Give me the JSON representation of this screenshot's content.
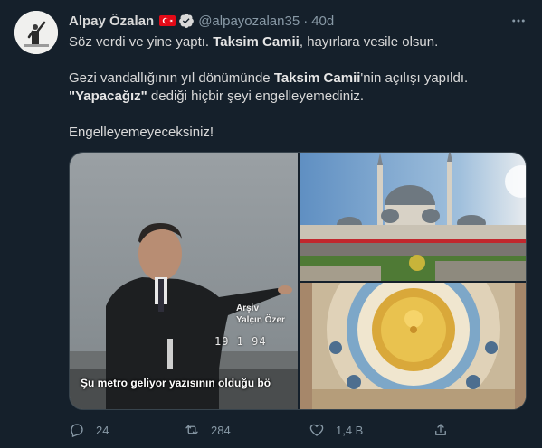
{
  "tweet": {
    "author_name": "Alpay Özalan",
    "handle": "@alpayozalan35",
    "separator": "·",
    "time": "40d",
    "text": {
      "line1_a": "Söz verdi ve yine yaptı. ",
      "line1_b": "Taksim Camii",
      "line1_c": ", hayırlara vesile olsun.",
      "line2_a": "Gezi vandallığının yıl dönümünde ",
      "line2_b": "Taksim Camii",
      "line2_c": "'nin açılışı yapıldı.",
      "line3_a": "\"Yapacağız\"",
      "line3_b": " dediği hiçbir şeyi engelleyemediniz.",
      "line4": "Engelleyemeyeceksiniz!"
    },
    "media": {
      "video_caption": "Şu metro geliyor yazısının olduğu bö",
      "archive_line1": "Arşiv",
      "archive_line2": "Yalçın Özer",
      "video_date": "19  1  94"
    },
    "actions": {
      "reply_count": "24",
      "retweet_count": "284",
      "like_count": "1,4 B"
    },
    "icons": [
      "turkey-flag-icon",
      "verified-badge-icon",
      "more-icon",
      "reply-icon",
      "retweet-icon",
      "like-icon",
      "share-icon"
    ],
    "colors": {
      "background": "#15202b",
      "secondary_text": "#8899a6",
      "verified": "#d9d9d9",
      "flag_red": "#e30a17"
    }
  }
}
